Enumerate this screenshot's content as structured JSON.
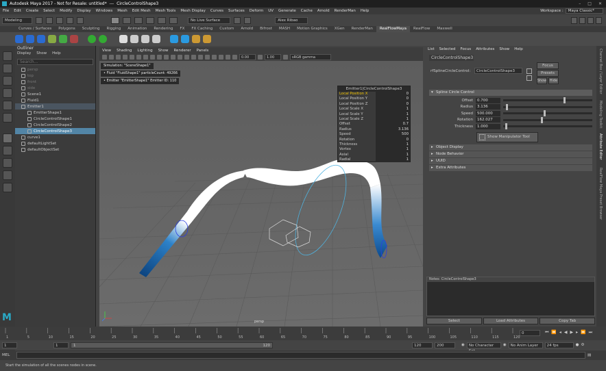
{
  "title_bar": {
    "app": "Autodesk Maya 2017 - Not for Resale: untitled*",
    "sep": "---",
    "node": "CircleControlShape3"
  },
  "menu": [
    "File",
    "Edit",
    "Create",
    "Select",
    "Modify",
    "Display",
    "Windows",
    "Mesh",
    "Edit Mesh",
    "Mesh Tools",
    "Mesh Display",
    "Curves",
    "Surfaces",
    "Deform",
    "UV",
    "Generate",
    "Cache",
    "Arnold",
    "RenderMan",
    "Help"
  ],
  "workspace": {
    "label": "Workspace :",
    "value": "Maya Classic*"
  },
  "status": {
    "mode": "Modeling",
    "live": "No Live Surface",
    "user": "Alex Ribao"
  },
  "shelf_tabs": [
    "Curves / Surfaces",
    "Polygons",
    "Sculpting",
    "Rigging",
    "Animation",
    "Rendering",
    "FX",
    "FX Caching",
    "Custom",
    "Arnold",
    "Bifrost",
    "MASH",
    "Motion Graphics",
    "XGen",
    "RenderMan",
    "RealFlowMaya",
    "RealFlow",
    "Maxwell"
  ],
  "shelf_active": "RealFlowMaya",
  "outliner": {
    "title": "Outliner",
    "menu": [
      "Display",
      "Show",
      "Help"
    ],
    "search": "Search...",
    "items": [
      {
        "label": "persp",
        "indent": 1,
        "state": "dim"
      },
      {
        "label": "top",
        "indent": 1,
        "state": "dim"
      },
      {
        "label": "front",
        "indent": 1,
        "state": "dim"
      },
      {
        "label": "side",
        "indent": 1,
        "state": "dim"
      },
      {
        "label": "Scene1",
        "indent": 1,
        "state": ""
      },
      {
        "label": "Fluid1",
        "indent": 1,
        "state": ""
      },
      {
        "label": "Emitter1",
        "indent": 1,
        "state": "hl"
      },
      {
        "label": "EmitterShape1",
        "indent": 2,
        "state": ""
      },
      {
        "label": "CircleControlShape1",
        "indent": 2,
        "state": ""
      },
      {
        "label": "CircleControlShape2",
        "indent": 2,
        "state": ""
      },
      {
        "label": "CircleControlShape3",
        "indent": 2,
        "state": "sel"
      },
      {
        "label": "curve1",
        "indent": 1,
        "state": ""
      },
      {
        "label": "defaultLightSet",
        "indent": 1,
        "state": ""
      },
      {
        "label": "defaultObjectSet",
        "indent": 1,
        "state": ""
      }
    ]
  },
  "viewport": {
    "menu": [
      "View",
      "Shading",
      "Lighting",
      "Show",
      "Renderer",
      "Panels"
    ],
    "val1": "0.00",
    "val2": "1.00",
    "colorspace": "sRGB gamma",
    "camera": "persp",
    "hud": [
      "Simulation: \"SceneShape1\"",
      "• Fluid \"FluidShape1\" particleCount: 49266",
      "• Emitter \"EmitterShape1\" Emitter ID: 110"
    ]
  },
  "channel_box": {
    "title": "Emitter1|CircleControlShape3",
    "rows": [
      {
        "n": "Local Position X",
        "v": "0",
        "hl": true
      },
      {
        "n": "Local Position Y",
        "v": "0"
      },
      {
        "n": "Local Position Z",
        "v": "0"
      },
      {
        "n": "Local Scale X",
        "v": "1"
      },
      {
        "n": "Local Scale Y",
        "v": "1"
      },
      {
        "n": "Local Scale Z",
        "v": "1"
      },
      {
        "n": "Offset",
        "v": "0.7"
      },
      {
        "n": "Radius",
        "v": "3.136"
      },
      {
        "n": "Speed",
        "v": "500"
      },
      {
        "n": "Rotation",
        "v": "0"
      },
      {
        "n": "Thickness",
        "v": "1"
      },
      {
        "n": "Vortex",
        "v": "1"
      },
      {
        "n": "Axial",
        "v": "1"
      },
      {
        "n": "Radial",
        "v": "1"
      }
    ]
  },
  "attribute_editor": {
    "menu": [
      "List",
      "Selected",
      "Focus",
      "Attributes",
      "Show",
      "Help"
    ],
    "tab": "CircleControlShape3",
    "node_label": "rfSplineCircleControl:",
    "node_value": "CircleControlShape3",
    "focus": "Focus",
    "presets": "Presets",
    "show": "Show",
    "hide": "Hide",
    "section": "Spline Circle Control",
    "attrs": [
      {
        "l": "Offset",
        "v": "0.700",
        "k": 0.68
      },
      {
        "l": "Radius",
        "v": "3.136",
        "k": 0.03
      },
      {
        "l": "Speed",
        "v": "500.000",
        "k": 0.45
      },
      {
        "l": "Rotation",
        "v": "162.027",
        "k": 0.42
      },
      {
        "l": "Thickness",
        "v": "1.000",
        "k": 0.02
      }
    ],
    "manip_btn": "Show Manipulator Tool",
    "sections": [
      "Object Display",
      "Node Behavior",
      "UUID",
      "Extra Attributes"
    ],
    "notes": "Notes: CircleControlShape3",
    "buttons": [
      "Select",
      "Load Attributes",
      "Copy Tab"
    ]
  },
  "right_dock": [
    "Channel Box / Layer Editor",
    "Modeling Toolkit",
    "Attribute Editor",
    "RealFlow Maya Preset Browser"
  ],
  "timeline": {
    "ticks": [
      "1",
      "5",
      "10",
      "15",
      "20",
      "25",
      "30",
      "35",
      "40",
      "45",
      "50",
      "55",
      "60",
      "65",
      "70",
      "75",
      "80",
      "85",
      "90",
      "95",
      "100",
      "105",
      "110",
      "115",
      "120"
    ],
    "frame": "0"
  },
  "range": {
    "start": "1",
    "start2": "1",
    "bar_start": "1",
    "bar_end": "120",
    "end": "120",
    "end2": "200",
    "char_set": "No Character Set",
    "anim_layer": "No Anim Layer",
    "fps": "24 fps"
  },
  "command": {
    "label": "MEL"
  },
  "help": "Start the simulation of all the scenes nodes in scene."
}
